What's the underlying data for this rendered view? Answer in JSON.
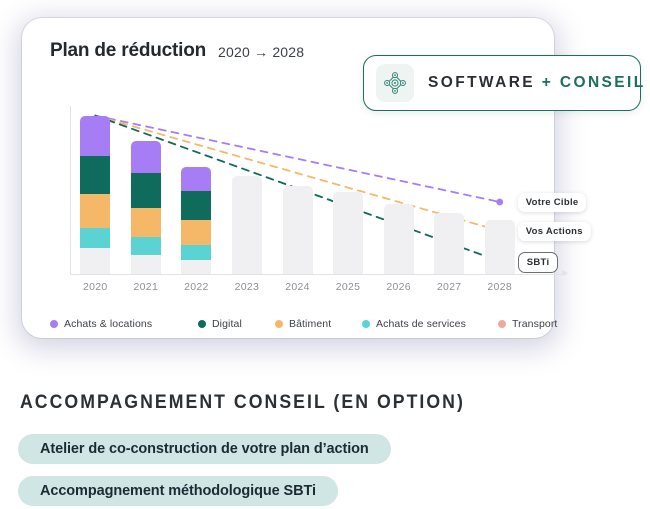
{
  "card": {
    "title": "Plan de réduction",
    "range": "2020 → 2028"
  },
  "logo": {
    "icon": "network-diamond-icon",
    "text_dark": "SOFTWARE",
    "text_green": "+ CONSEIL",
    "border_color": "#1b6f5e"
  },
  "chart_data": {
    "type": "bar",
    "subtype": "stacked-bar-with-trendlines",
    "title": "Plan de réduction",
    "xlabel": "",
    "ylabel": "",
    "grid": false,
    "legend_position": "bottom",
    "categories": [
      "2020",
      "2021",
      "2022",
      "2023",
      "2024",
      "2025",
      "2026",
      "2027",
      "2028"
    ],
    "series": [
      {
        "name": "Achats & locations",
        "color": "#a77df5",
        "values": [
          25,
          20,
          15,
          null,
          null,
          null,
          null,
          null,
          null
        ]
      },
      {
        "name": "Digital",
        "color": "#0f6b5c",
        "values": [
          24,
          22,
          18,
          null,
          null,
          null,
          null,
          null,
          null
        ]
      },
      {
        "name": "Bâtiment",
        "color": "#f5b869",
        "values": [
          21,
          18,
          16,
          null,
          null,
          null,
          null,
          null,
          null
        ]
      },
      {
        "name": "Achats de services",
        "color": "#5bd3d3",
        "values": [
          13,
          11,
          9,
          null,
          null,
          null,
          null,
          null,
          null
        ]
      },
      {
        "name": "Transport",
        "color": "#f0f0f2",
        "values": [
          16,
          12,
          9,
          null,
          null,
          null,
          null,
          null,
          null
        ]
      }
    ],
    "projected_bars": {
      "note": "grey placeholder bars for future years",
      "color": "#f0f0f2",
      "categories": [
        "2023",
        "2024",
        "2025",
        "2026",
        "2027",
        "2028"
      ],
      "values": [
        61,
        55,
        51,
        44,
        38,
        34
      ]
    },
    "trendlines": [
      {
        "name": "Votre Cible",
        "color": "#a77df5",
        "style": "dashed",
        "start": 99,
        "end": 45
      },
      {
        "name": "Vos Actions",
        "color": "#f5b869",
        "style": "dashed",
        "start": 99,
        "end": 27
      },
      {
        "name": "SBTi",
        "color": "#0f6b5c",
        "style": "dashed",
        "start": 99,
        "end": 8
      }
    ],
    "endpoint_labels": [
      {
        "label": "Votre Cible",
        "color": "#a77df5",
        "outlined": false
      },
      {
        "label": "Vos Actions",
        "color": "#f5b869",
        "outlined": false
      },
      {
        "label": "SBTi",
        "color": "#0f6b5c",
        "outlined": true
      }
    ],
    "legend": [
      {
        "label": "Achats & locations",
        "color": "#a77df5"
      },
      {
        "label": "Digital",
        "color": "#0f6b5c"
      },
      {
        "label": "Bâtiment",
        "color": "#f5b869"
      },
      {
        "label": "Achats de services",
        "color": "#5bd3d3"
      },
      {
        "label": "Transport",
        "color": "#eda9a0"
      }
    ]
  },
  "bottom": {
    "section_title": "ACCOMPAGNEMENT CONSEIL (EN OPTION)",
    "chips": [
      "Atelier de co-construction de votre plan d’action",
      "Accompagnement méthodologique SBTi"
    ],
    "chip_color": "#cfe6e4"
  }
}
